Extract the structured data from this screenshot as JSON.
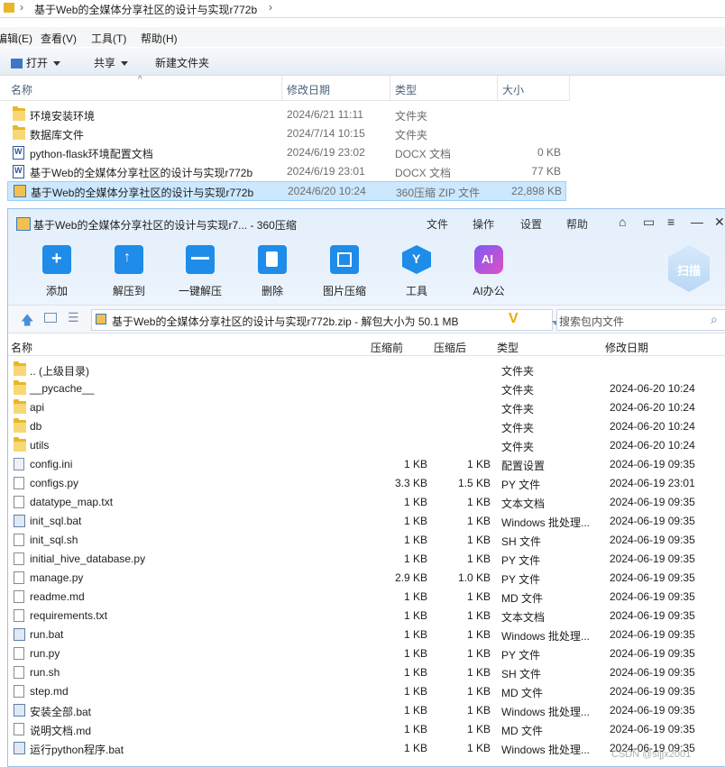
{
  "explorer": {
    "breadcrumb": "基于Web的全媒体分享社区的设计与实现r772b",
    "menu": [
      "编辑(E)",
      "查看(V)",
      "工具(T)",
      "帮助(H)"
    ],
    "toolbar": {
      "open": "打开",
      "share": "共享",
      "new_folder": "新建文件夹"
    },
    "columns": {
      "name": "名称",
      "date": "修改日期",
      "type": "类型",
      "size": "大小"
    },
    "rows": [
      {
        "name": "环境安装环境",
        "date": "2024/6/21 11:11",
        "type": "文件夹",
        "size": "",
        "icon": "folder-icon"
      },
      {
        "name": "数据库文件",
        "date": "2024/7/14 10:15",
        "type": "文件夹",
        "size": "",
        "icon": "folder-icon"
      },
      {
        "name": "python-flask环境配置文档",
        "date": "2024/6/19 23:02",
        "type": "DOCX 文档",
        "size": "0 KB",
        "icon": "docx-icon"
      },
      {
        "name": "基于Web的全媒体分享社区的设计与实现r772b",
        "date": "2024/6/19 23:01",
        "type": "DOCX 文档",
        "size": "77 KB",
        "icon": "docx-icon"
      },
      {
        "name": "基于Web的全媒体分享社区的设计与实现r772b",
        "date": "2024/6/20 10:24",
        "type": "360压缩 ZIP 文件",
        "size": "22,898 KB",
        "icon": "zip-icon"
      }
    ]
  },
  "zip_window": {
    "title": "基于Web的全媒体分享社区的设计与实现r7... - 360压缩",
    "menu": [
      "文件",
      "操作",
      "设置",
      "帮助"
    ],
    "tools": [
      "添加",
      "解压到",
      "一键解压",
      "删除",
      "图片压缩",
      "工具",
      "AI办公"
    ],
    "scan_label": "扫描",
    "path": "基于Web的全媒体分享社区的设计与实现r772b.zip - 解包大小为 50.1 MB",
    "search_placeholder": "搜索包内文件",
    "columns": {
      "name": "名称",
      "orig": "压缩前",
      "packed": "压缩后",
      "type": "类型",
      "date": "修改日期"
    },
    "rows": [
      {
        "name": ".. (上级目录)",
        "orig": "",
        "packed": "",
        "type": "文件夹",
        "date": "",
        "icon": "folder-icon"
      },
      {
        "name": "__pycache__",
        "orig": "",
        "packed": "",
        "type": "文件夹",
        "date": "2024-06-20 10:24",
        "icon": "folder-icon"
      },
      {
        "name": "api",
        "orig": "",
        "packed": "",
        "type": "文件夹",
        "date": "2024-06-20 10:24",
        "icon": "folder-icon"
      },
      {
        "name": "db",
        "orig": "",
        "packed": "",
        "type": "文件夹",
        "date": "2024-06-20 10:24",
        "icon": "folder-icon"
      },
      {
        "name": "utils",
        "orig": "",
        "packed": "",
        "type": "文件夹",
        "date": "2024-06-20 10:24",
        "icon": "folder-icon"
      },
      {
        "name": "config.ini",
        "orig": "1 KB",
        "packed": "1 KB",
        "type": "配置设置",
        "date": "2024-06-19 09:35",
        "icon": "ini-icon"
      },
      {
        "name": "configs.py",
        "orig": "3.3 KB",
        "packed": "1.5 KB",
        "type": "PY 文件",
        "date": "2024-06-19 23:01",
        "icon": "file-icon"
      },
      {
        "name": "datatype_map.txt",
        "orig": "1 KB",
        "packed": "1 KB",
        "type": "文本文档",
        "date": "2024-06-19 09:35",
        "icon": "file-icon"
      },
      {
        "name": "init_sql.bat",
        "orig": "1 KB",
        "packed": "1 KB",
        "type": "Windows 批处理...",
        "date": "2024-06-19 09:35",
        "icon": "bat-icon"
      },
      {
        "name": "init_sql.sh",
        "orig": "1 KB",
        "packed": "1 KB",
        "type": "SH 文件",
        "date": "2024-06-19 09:35",
        "icon": "file-icon"
      },
      {
        "name": "initial_hive_database.py",
        "orig": "1 KB",
        "packed": "1 KB",
        "type": "PY 文件",
        "date": "2024-06-19 09:35",
        "icon": "file-icon"
      },
      {
        "name": "manage.py",
        "orig": "2.9 KB",
        "packed": "1.0 KB",
        "type": "PY 文件",
        "date": "2024-06-19 09:35",
        "icon": "file-icon"
      },
      {
        "name": "readme.md",
        "orig": "1 KB",
        "packed": "1 KB",
        "type": "MD 文件",
        "date": "2024-06-19 09:35",
        "icon": "file-icon"
      },
      {
        "name": "requirements.txt",
        "orig": "1 KB",
        "packed": "1 KB",
        "type": "文本文档",
        "date": "2024-06-19 09:35",
        "icon": "file-icon"
      },
      {
        "name": "run.bat",
        "orig": "1 KB",
        "packed": "1 KB",
        "type": "Windows 批处理...",
        "date": "2024-06-19 09:35",
        "icon": "bat-icon"
      },
      {
        "name": "run.py",
        "orig": "1 KB",
        "packed": "1 KB",
        "type": "PY 文件",
        "date": "2024-06-19 09:35",
        "icon": "file-icon"
      },
      {
        "name": "run.sh",
        "orig": "1 KB",
        "packed": "1 KB",
        "type": "SH 文件",
        "date": "2024-06-19 09:35",
        "icon": "file-icon"
      },
      {
        "name": "step.md",
        "orig": "1 KB",
        "packed": "1 KB",
        "type": "MD 文件",
        "date": "2024-06-19 09:35",
        "icon": "file-icon"
      },
      {
        "name": "安装全部.bat",
        "orig": "1 KB",
        "packed": "1 KB",
        "type": "Windows 批处理...",
        "date": "2024-06-19 09:35",
        "icon": "bat-icon"
      },
      {
        "name": "说明文档.md",
        "orig": "1 KB",
        "packed": "1 KB",
        "type": "MD 文件",
        "date": "2024-06-19 09:35",
        "icon": "file-icon"
      },
      {
        "name": "运行python程序.bat",
        "orig": "1 KB",
        "packed": "1 KB",
        "type": "Windows 批处理...",
        "date": "2024-06-19 09:35",
        "icon": "bat-icon"
      }
    ]
  },
  "watermark": "CSDN @sijjx2001"
}
